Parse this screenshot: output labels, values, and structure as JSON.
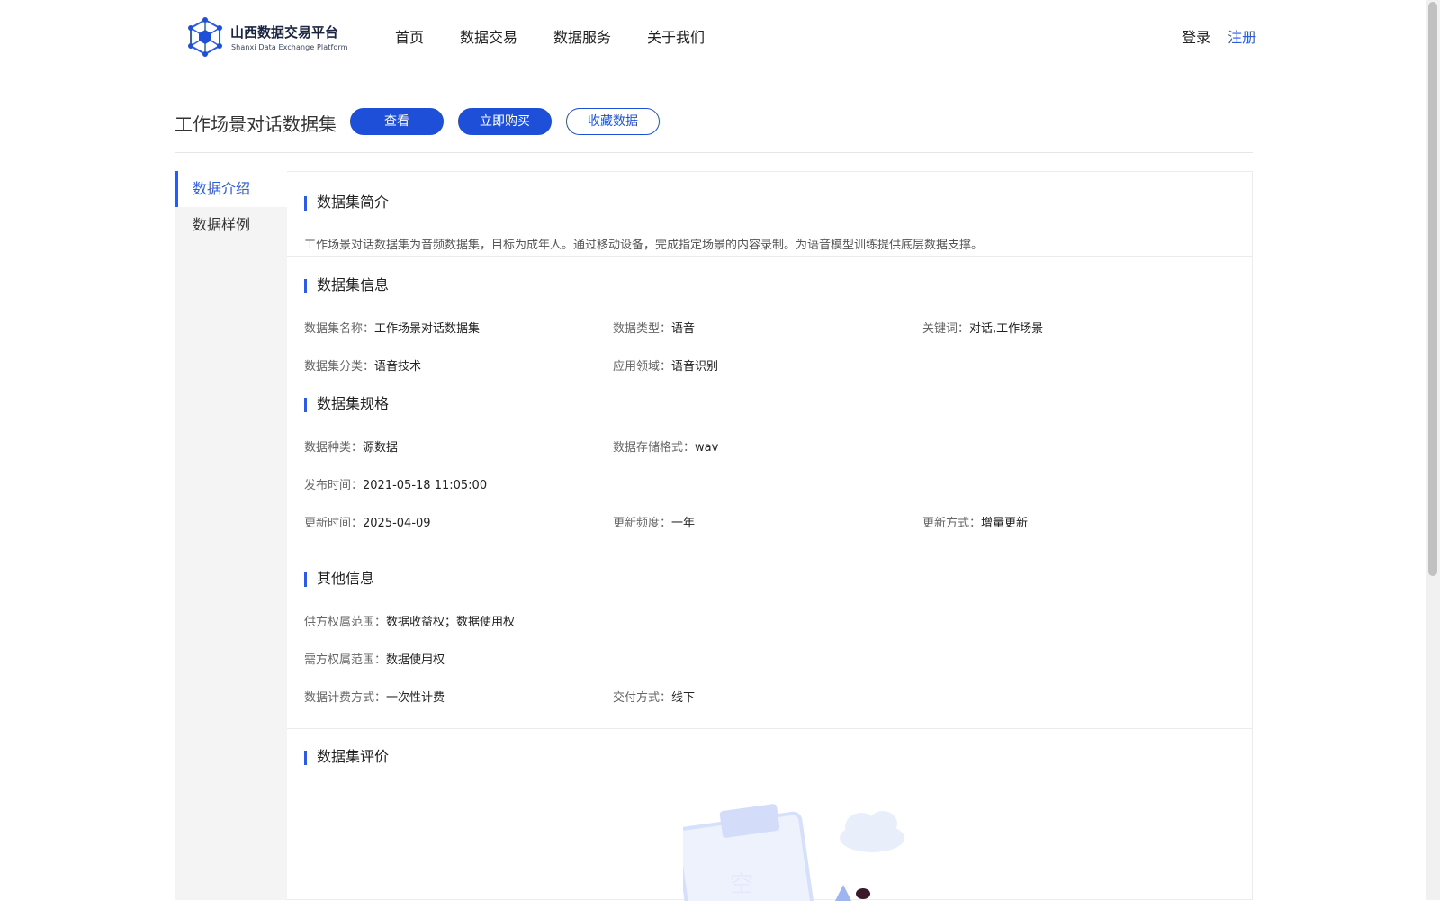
{
  "header": {
    "logo_cn": "山西数据交易平台",
    "logo_en": "Shanxi Data Exchange Platform",
    "nav": [
      "首页",
      "数据交易",
      "数据服务",
      "关于我们"
    ],
    "login": "登录",
    "register": "注册"
  },
  "dataset": {
    "title": "工作场景对话数据集",
    "buttons": {
      "view": "查看",
      "buy": "立即购买",
      "favorite": "收藏数据"
    }
  },
  "sidebar": {
    "items": [
      {
        "label": "数据介绍",
        "active": true
      },
      {
        "label": "数据样例",
        "active": false
      }
    ]
  },
  "sections": {
    "intro": {
      "title": "数据集简介",
      "text": "工作场景对话数据集为音频数据集，目标为成年人。通过移动设备，完成指定场景的内容录制。为语音模型训练提供底层数据支撑。"
    },
    "info": {
      "title": "数据集信息",
      "fields": [
        {
          "key": "数据集名称：",
          "value": "工作场景对话数据集"
        },
        {
          "key": "数据类型：",
          "value": "语音"
        },
        {
          "key": "关键词：",
          "value": "对话,工作场景"
        },
        {
          "key": "数据集分类：",
          "value": "语音技术"
        },
        {
          "key": "应用领域：",
          "value": "语音识别"
        }
      ]
    },
    "spec": {
      "title": "数据集规格",
      "fields": [
        {
          "key": "数据种类：",
          "value": "源数据"
        },
        {
          "key": "数据存储格式：",
          "value": "wav"
        },
        {
          "key": "发布时间：",
          "value": "2021-05-18 11:05:00"
        },
        {
          "key": "更新时间：",
          "value": "2025-04-09"
        },
        {
          "key": "更新频度：",
          "value": "一年"
        },
        {
          "key": "更新方式：",
          "value": "增量更新"
        }
      ]
    },
    "other": {
      "title": "其他信息",
      "fields": [
        {
          "key": "供方权属范围：",
          "value": "数据收益权；数据使用权"
        },
        {
          "key": "需方权属范围：",
          "value": "数据使用权"
        },
        {
          "key": "数据计费方式：",
          "value": "一次性计费"
        },
        {
          "key": "交付方式：",
          "value": "线下"
        }
      ]
    },
    "review": {
      "title": "数据集评价"
    }
  },
  "colors": {
    "accent": "#1e4fd8",
    "link": "#2d5be3",
    "sidebar_bg": "#f4f4f4"
  }
}
